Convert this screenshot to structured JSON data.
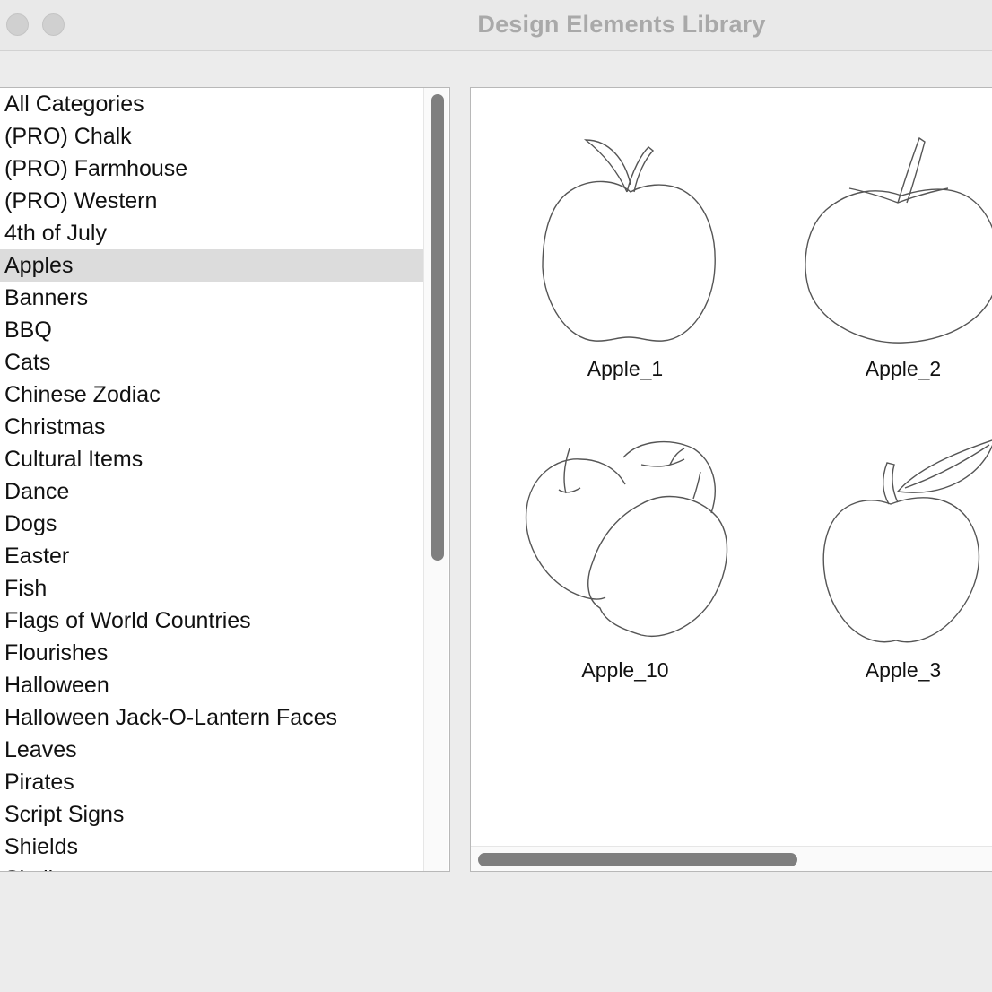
{
  "window": {
    "title": "Design Elements Library"
  },
  "categories": {
    "selected": "Apples",
    "items": [
      "All Categories",
      "(PRO) Chalk",
      "(PRO) Farmhouse",
      "(PRO) Western",
      "4th of July",
      "Apples",
      "Banners",
      "BBQ",
      "Cats",
      "Chinese Zodiac",
      "Christmas",
      "Cultural Items",
      "Dance",
      "Dogs",
      "Easter",
      "Fish",
      "Flags of World Countries",
      "Flourishes",
      "Halloween",
      "Halloween Jack-O-Lantern Faces",
      "Leaves",
      "Pirates",
      "Script Signs",
      "Shields",
      "Skulls"
    ]
  },
  "elements": {
    "items": [
      {
        "label": "Apple_1",
        "icon": "apple-with-leaf-icon"
      },
      {
        "label": "Apple_2",
        "icon": "round-apple-icon"
      },
      {
        "label": "Apple_10",
        "icon": "three-apples-icon"
      },
      {
        "label": "Apple_3",
        "icon": "apple-with-large-leaf-icon"
      }
    ]
  }
}
